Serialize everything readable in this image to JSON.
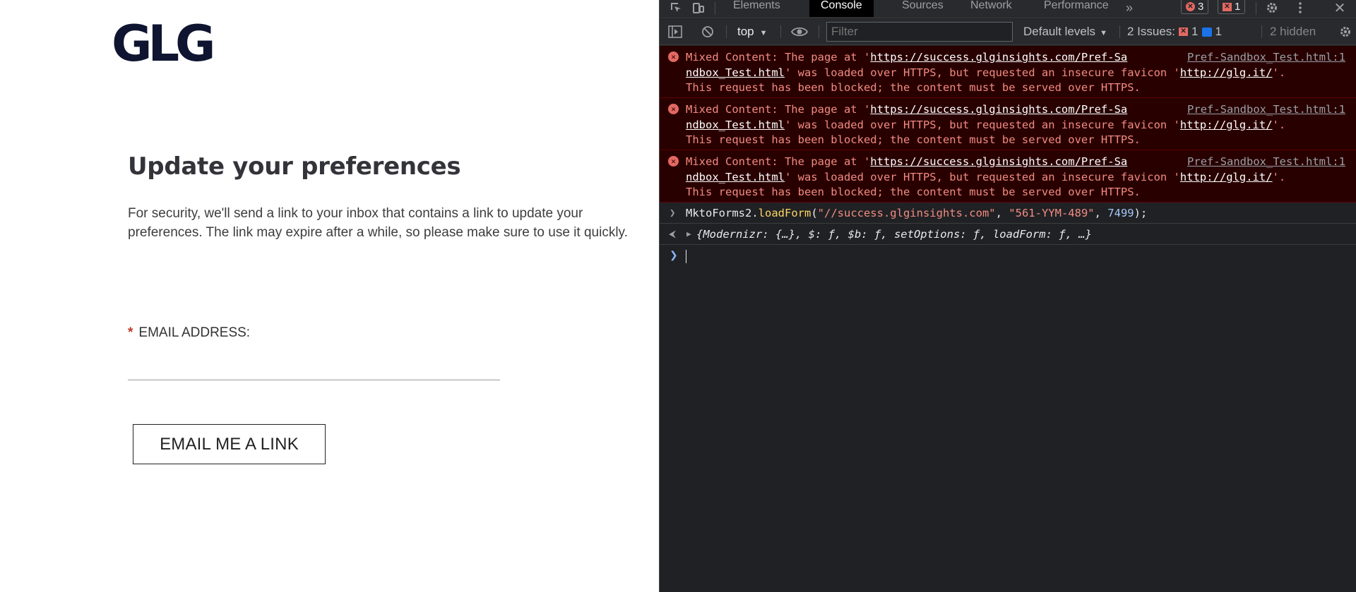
{
  "page": {
    "logo": "GLG",
    "heading": "Update your preferences",
    "description": "For security, we'll send a link to your inbox that contains a link to update your preferences. The link may expire after a while, so please make sure to use it quickly.",
    "field_required_mark": "*",
    "field_label": "EMAIL ADDRESS:",
    "email_value": "",
    "submit_label": "EMAIL ME A LINK"
  },
  "devtools": {
    "tabs": [
      "Elements",
      "Console",
      "Sources",
      "Network",
      "Performance"
    ],
    "active_tab": "Console",
    "more_tabs_icon": "»",
    "error_count": "3",
    "issue_count_badge": "1",
    "toolbar": {
      "context": "top",
      "filter_placeholder": "Filter",
      "levels": "Default levels",
      "issues_label": "2 Issues:",
      "issues_errors": "1",
      "issues_info": "1",
      "hidden": "2 hidden"
    },
    "messages": [
      {
        "prefix": "Mixed Content: The page at '",
        "url1a": "https://success.glginsights.com/Pref-Sa",
        "url1b": "ndbox_Test.html",
        "mid": "' was loaded over HTTPS, but requested an insecure favicon '",
        "url2": "http://glg.it/",
        "end": "'.",
        "line3": "This request has been blocked; the content must be served over HTTPS.",
        "source": "Pref-Sandbox_Test.html:1"
      },
      {
        "prefix": "Mixed Content: The page at '",
        "url1a": "https://success.glginsights.com/Pref-Sa",
        "url1b": "ndbox_Test.html",
        "mid": "' was loaded over HTTPS, but requested an insecure favicon '",
        "url2": "http://glg.it/",
        "end": "'.",
        "line3": "This request has been blocked; the content must be served over HTTPS.",
        "source": "Pref-Sandbox_Test.html:1"
      },
      {
        "prefix": "Mixed Content: The page at '",
        "url1a": "https://success.glginsights.com/Pref-Sa",
        "url1b": "ndbox_Test.html",
        "mid": "' was loaded over HTTPS, but requested an insecure favicon '",
        "url2": "http://glg.it/",
        "end": "'.",
        "line3": "This request has been blocked; the content must be served over HTTPS.",
        "source": "Pref-Sandbox_Test.html:1"
      }
    ],
    "input": {
      "obj": "MktoForms2.",
      "fn": "loadForm",
      "open": "(",
      "arg1": "\"//success.glginsights.com\"",
      "sep1": ", ",
      "arg2": "\"561-YYM-489\"",
      "sep2": ", ",
      "arg3": "7499",
      "close": ");"
    },
    "output": "{Modernizr: {…}, $: ƒ, $b: ƒ, setOptions: ƒ, loadForm: ƒ, …}",
    "colors": {
      "panel_bg": "#202124",
      "error_bg": "#290000",
      "error_text": "#f28b82",
      "accent_blue": "#8ab4f8",
      "brand_navy": "#0f1530"
    }
  }
}
